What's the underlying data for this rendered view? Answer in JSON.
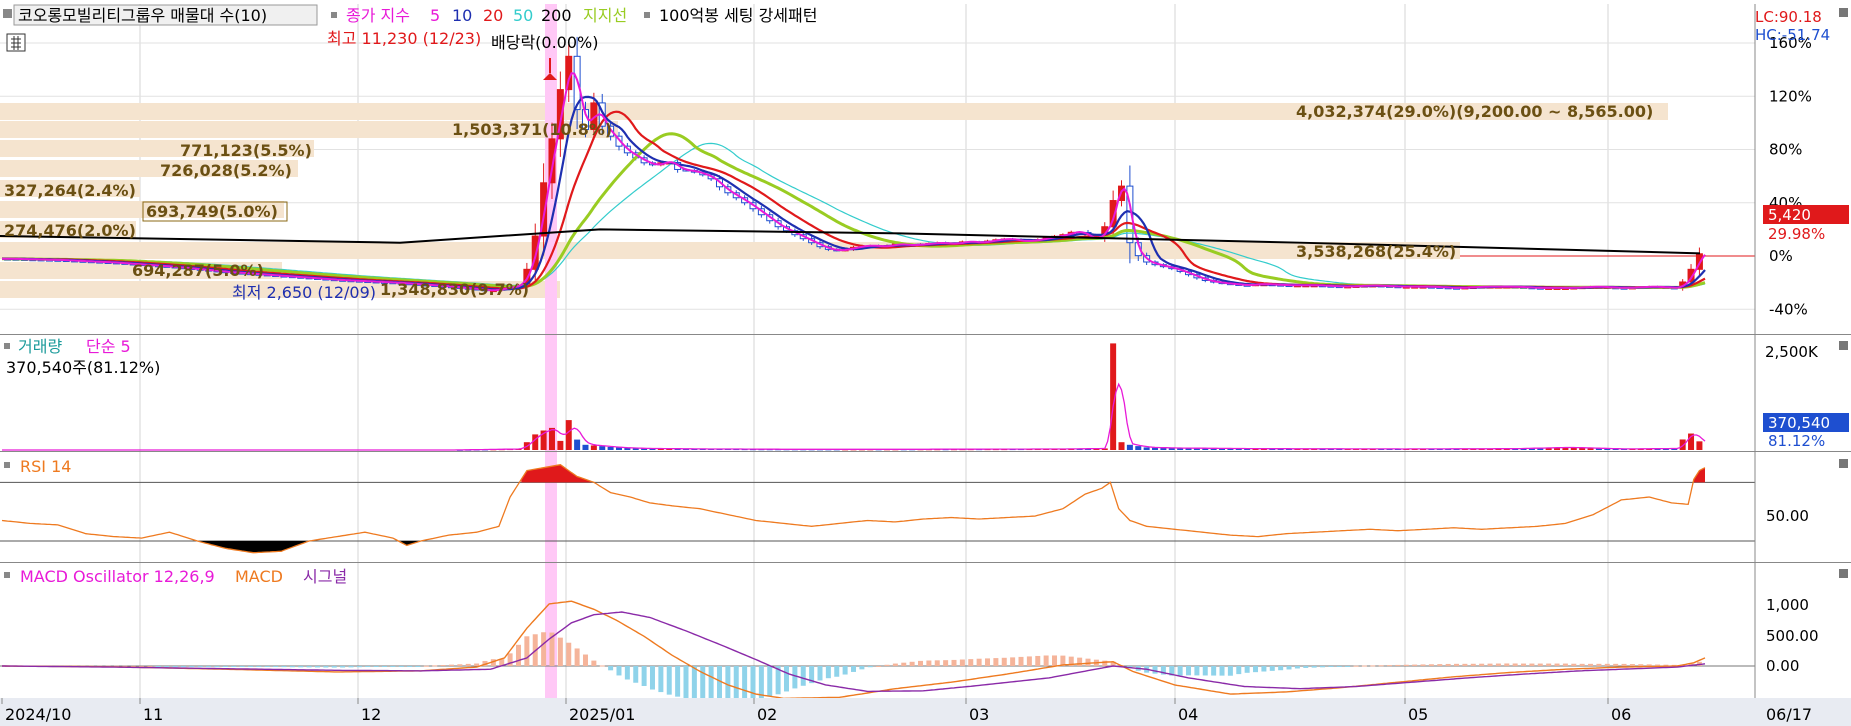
{
  "colors": {
    "up": "#e0191b",
    "down": "#1e4fd0",
    "ma5": "#e81ad8",
    "ma10": "#1e2fb0",
    "ma20": "#e0191b",
    "ma50": "#33cccc",
    "ma200": "#000000",
    "support": "#99cc22",
    "rsi": "#ee7a20",
    "macd": "#ee7a20",
    "signal": "#8a2aa8",
    "osc_pos": "#f5b49a",
    "osc_neg": "#8fd3ea",
    "band": "#f5e4cf",
    "highlight": "#ffc8f6"
  },
  "legend": {
    "title": "코오롱모빌리티그룹우 매물대 수(10)",
    "close_index": "종가 지수",
    "ma_periods": [
      "5",
      "10",
      "20",
      "50",
      "200"
    ],
    "support": "지지선",
    "setting": "100억봉 세팅 강세패턴"
  },
  "annotations": {
    "high": "최고 11,230 (12/23)",
    "low": "최저 2,650 (12/09)",
    "dividend": "배당락(0.00%)"
  },
  "right_info": {
    "lc": "LC:90.18",
    "hc": "HC:-51.74"
  },
  "price_tag": {
    "price": "5,420",
    "change": "29.98%"
  },
  "volume_panel": {
    "title": "거래량",
    "ma_label": "단순 5",
    "current": "370,540주(81.12%)",
    "tag_value": "370,540",
    "tag_pct": "81.12%",
    "y_axis_label": "2,500K"
  },
  "rsi_panel": {
    "title": "RSI 14",
    "level_label": "50.00"
  },
  "macd_panel": {
    "title": "MACD Oscillator 12,26,9",
    "macd_label": "MACD",
    "signal_label": "시그널",
    "y_axis_labels": [
      "1,000",
      "500.00",
      "0.00"
    ]
  },
  "x_axis": {
    "labels": [
      "2024/10",
      "11",
      "12",
      "2025/01",
      "02",
      "03",
      "04",
      "05",
      "06",
      "06/17"
    ]
  },
  "chart_data": {
    "type": "candlestick",
    "title": "코오롱모빌리티그룹우 매물대 수(10)",
    "y_axis_price_pct": {
      "ticks": [
        "160%",
        "120%",
        "80%",
        "40%",
        "0%",
        "-40%"
      ],
      "range": [
        -52,
        165
      ]
    },
    "volume_profile": [
      {
        "label": "4,032,374(29.0%)(9,200.00 ~ 8,565.00)",
        "pct": 29.0,
        "range": "9,200.00 ~ 8,565.00"
      },
      {
        "label": "1,503,371(10.8%)",
        "pct": 10.8
      },
      {
        "label": "771,123(5.5%)",
        "pct": 5.5
      },
      {
        "label": "726,028(5.2%)",
        "pct": 5.2
      },
      {
        "label": "327,264(2.4%)",
        "pct": 2.4
      },
      {
        "label": "693,749(5.0%)",
        "pct": 5.0
      },
      {
        "label": "274,476(2.0%)",
        "pct": 2.0
      },
      {
        "label": "3,538,268(25.4%)",
        "pct": 25.4
      },
      {
        "label": "694,287(5.0%)",
        "pct": 5.0
      },
      {
        "label": "1,348,830(9.7%)",
        "pct": 9.7
      }
    ],
    "price_pct_path": [
      [
        0,
        -2
      ],
      [
        20,
        -3
      ],
      [
        40,
        -5
      ],
      [
        60,
        -8
      ],
      [
        80,
        -12
      ],
      [
        100,
        -15
      ],
      [
        120,
        -18
      ],
      [
        140,
        -20
      ],
      [
        160,
        -23
      ],
      [
        175,
        -26
      ],
      [
        185,
        -22
      ],
      [
        188,
        -10
      ],
      [
        191,
        15
      ],
      [
        194,
        55
      ],
      [
        197,
        88
      ],
      [
        200,
        125
      ],
      [
        203,
        150
      ],
      [
        206,
        110
      ],
      [
        209,
        95
      ],
      [
        212,
        115
      ],
      [
        214,
        100
      ],
      [
        218,
        90
      ],
      [
        222,
        80
      ],
      [
        226,
        75
      ],
      [
        230,
        70
      ],
      [
        234,
        68
      ],
      [
        238,
        72
      ],
      [
        242,
        65
      ],
      [
        246,
        64
      ],
      [
        250,
        62
      ],
      [
        254,
        58
      ],
      [
        258,
        50
      ],
      [
        262,
        45
      ],
      [
        266,
        40
      ],
      [
        270,
        34
      ],
      [
        274,
        28
      ],
      [
        278,
        22
      ],
      [
        282,
        18
      ],
      [
        286,
        14
      ],
      [
        290,
        10
      ],
      [
        294,
        6
      ],
      [
        298,
        4
      ],
      [
        302,
        5
      ],
      [
        306,
        7
      ],
      [
        310,
        8
      ],
      [
        315,
        7
      ],
      [
        320,
        9
      ],
      [
        325,
        8
      ],
      [
        330,
        9
      ],
      [
        335,
        10
      ],
      [
        340,
        9
      ],
      [
        345,
        11
      ],
      [
        350,
        10
      ],
      [
        355,
        12
      ],
      [
        360,
        13
      ],
      [
        365,
        11
      ],
      [
        370,
        12
      ],
      [
        375,
        14
      ],
      [
        380,
        16
      ],
      [
        385,
        19
      ],
      [
        388,
        15
      ],
      [
        391,
        12
      ],
      [
        394,
        18
      ],
      [
        397,
        30
      ],
      [
        400,
        65
      ],
      [
        402,
        40
      ],
      [
        404,
        10
      ],
      [
        408,
        -3
      ],
      [
        412,
        -6
      ],
      [
        416,
        -8
      ],
      [
        420,
        -10
      ],
      [
        425,
        -14
      ],
      [
        430,
        -18
      ],
      [
        435,
        -20
      ],
      [
        440,
        -21
      ],
      [
        445,
        -22
      ],
      [
        450,
        -21
      ],
      [
        460,
        -22
      ],
      [
        470,
        -22
      ],
      [
        480,
        -23
      ],
      [
        490,
        -22
      ],
      [
        500,
        -23
      ],
      [
        510,
        -23
      ],
      [
        520,
        -24
      ],
      [
        530,
        -23
      ],
      [
        540,
        -23
      ],
      [
        550,
        -24
      ],
      [
        560,
        -24
      ],
      [
        570,
        -23
      ],
      [
        580,
        -24
      ],
      [
        590,
        -23
      ],
      [
        600,
        -24
      ],
      [
        604,
        -15
      ],
      [
        607,
        0
      ],
      [
        610,
        5
      ]
    ],
    "volume_path": [
      [
        0,
        0
      ],
      [
        160,
        0
      ],
      [
        175,
        5
      ],
      [
        185,
        8
      ],
      [
        188,
        60
      ],
      [
        191,
        120
      ],
      [
        194,
        150
      ],
      [
        197,
        170
      ],
      [
        200,
        70
      ],
      [
        203,
        230
      ],
      [
        206,
        80
      ],
      [
        209,
        40
      ],
      [
        212,
        35
      ],
      [
        215,
        30
      ],
      [
        220,
        20
      ],
      [
        225,
        15
      ],
      [
        230,
        12
      ],
      [
        240,
        10
      ],
      [
        250,
        8
      ],
      [
        260,
        8
      ],
      [
        270,
        6
      ],
      [
        300,
        5
      ],
      [
        340,
        6
      ],
      [
        380,
        8
      ],
      [
        395,
        12
      ],
      [
        398,
        820
      ],
      [
        401,
        60
      ],
      [
        404,
        40
      ],
      [
        410,
        20
      ],
      [
        420,
        15
      ],
      [
        450,
        10
      ],
      [
        500,
        8
      ],
      [
        540,
        10
      ],
      [
        560,
        20
      ],
      [
        580,
        8
      ],
      [
        600,
        12
      ],
      [
        604,
        150
      ],
      [
        607,
        80
      ],
      [
        610,
        40
      ]
    ],
    "rsi_path": [
      [
        0,
        44
      ],
      [
        10,
        42
      ],
      [
        20,
        41
      ],
      [
        30,
        35
      ],
      [
        40,
        33
      ],
      [
        50,
        32
      ],
      [
        60,
        36
      ],
      [
        70,
        30
      ],
      [
        80,
        25
      ],
      [
        90,
        22
      ],
      [
        100,
        23
      ],
      [
        110,
        30
      ],
      [
        120,
        33
      ],
      [
        130,
        36
      ],
      [
        140,
        32
      ],
      [
        145,
        27
      ],
      [
        150,
        30
      ],
      [
        160,
        34
      ],
      [
        170,
        36
      ],
      [
        178,
        40
      ],
      [
        182,
        60
      ],
      [
        188,
        78
      ],
      [
        194,
        80
      ],
      [
        200,
        82
      ],
      [
        206,
        74
      ],
      [
        212,
        70
      ],
      [
        218,
        63
      ],
      [
        225,
        60
      ],
      [
        232,
        56
      ],
      [
        240,
        54
      ],
      [
        250,
        52
      ],
      [
        260,
        48
      ],
      [
        270,
        44
      ],
      [
        280,
        42
      ],
      [
        290,
        40
      ],
      [
        300,
        42
      ],
      [
        310,
        44
      ],
      [
        320,
        43
      ],
      [
        330,
        45
      ],
      [
        340,
        46
      ],
      [
        350,
        45
      ],
      [
        360,
        46
      ],
      [
        370,
        47
      ],
      [
        380,
        52
      ],
      [
        388,
        62
      ],
      [
        394,
        66
      ],
      [
        397,
        70
      ],
      [
        400,
        52
      ],
      [
        404,
        44
      ],
      [
        410,
        40
      ],
      [
        420,
        38
      ],
      [
        430,
        36
      ],
      [
        440,
        34
      ],
      [
        450,
        33
      ],
      [
        460,
        35
      ],
      [
        470,
        36
      ],
      [
        480,
        37
      ],
      [
        490,
        38
      ],
      [
        500,
        37
      ],
      [
        510,
        38
      ],
      [
        520,
        39
      ],
      [
        530,
        38
      ],
      [
        540,
        39
      ],
      [
        550,
        40
      ],
      [
        560,
        42
      ],
      [
        570,
        48
      ],
      [
        580,
        58
      ],
      [
        590,
        60
      ],
      [
        598,
        56
      ],
      [
        604,
        55
      ],
      [
        606,
        72
      ],
      [
        608,
        78
      ],
      [
        610,
        80
      ]
    ],
    "macd_path": [
      [
        0,
        0
      ],
      [
        40,
        -15
      ],
      [
        80,
        -60
      ],
      [
        120,
        -110
      ],
      [
        150,
        -90
      ],
      [
        170,
        -20
      ],
      [
        180,
        150
      ],
      [
        188,
        700
      ],
      [
        196,
        1150
      ],
      [
        204,
        1200
      ],
      [
        212,
        1050
      ],
      [
        220,
        850
      ],
      [
        230,
        550
      ],
      [
        240,
        200
      ],
      [
        250,
        -100
      ],
      [
        260,
        -350
      ],
      [
        270,
        -520
      ],
      [
        280,
        -600
      ],
      [
        300,
        -580
      ],
      [
        320,
        -420
      ],
      [
        340,
        -300
      ],
      [
        360,
        -150
      ],
      [
        380,
        20
      ],
      [
        398,
        80
      ],
      [
        405,
        -100
      ],
      [
        420,
        -350
      ],
      [
        440,
        -520
      ],
      [
        460,
        -480
      ],
      [
        480,
        -400
      ],
      [
        500,
        -300
      ],
      [
        520,
        -200
      ],
      [
        540,
        -120
      ],
      [
        560,
        -60
      ],
      [
        580,
        -20
      ],
      [
        600,
        0
      ],
      [
        606,
        60
      ],
      [
        610,
        150
      ]
    ],
    "signal_path": [
      [
        0,
        0
      ],
      [
        40,
        -20
      ],
      [
        80,
        -50
      ],
      [
        120,
        -80
      ],
      [
        150,
        -90
      ],
      [
        175,
        -60
      ],
      [
        188,
        150
      ],
      [
        196,
        500
      ],
      [
        204,
        800
      ],
      [
        212,
        950
      ],
      [
        222,
        1000
      ],
      [
        232,
        900
      ],
      [
        245,
        650
      ],
      [
        258,
        380
      ],
      [
        270,
        120
      ],
      [
        282,
        -150
      ],
      [
        295,
        -350
      ],
      [
        310,
        -470
      ],
      [
        330,
        -460
      ],
      [
        350,
        -360
      ],
      [
        375,
        -220
      ],
      [
        398,
        0
      ],
      [
        410,
        -60
      ],
      [
        425,
        -220
      ],
      [
        445,
        -380
      ],
      [
        465,
        -420
      ],
      [
        485,
        -380
      ],
      [
        505,
        -300
      ],
      [
        525,
        -220
      ],
      [
        545,
        -150
      ],
      [
        565,
        -90
      ],
      [
        585,
        -50
      ],
      [
        600,
        -20
      ],
      [
        610,
        40
      ]
    ]
  }
}
